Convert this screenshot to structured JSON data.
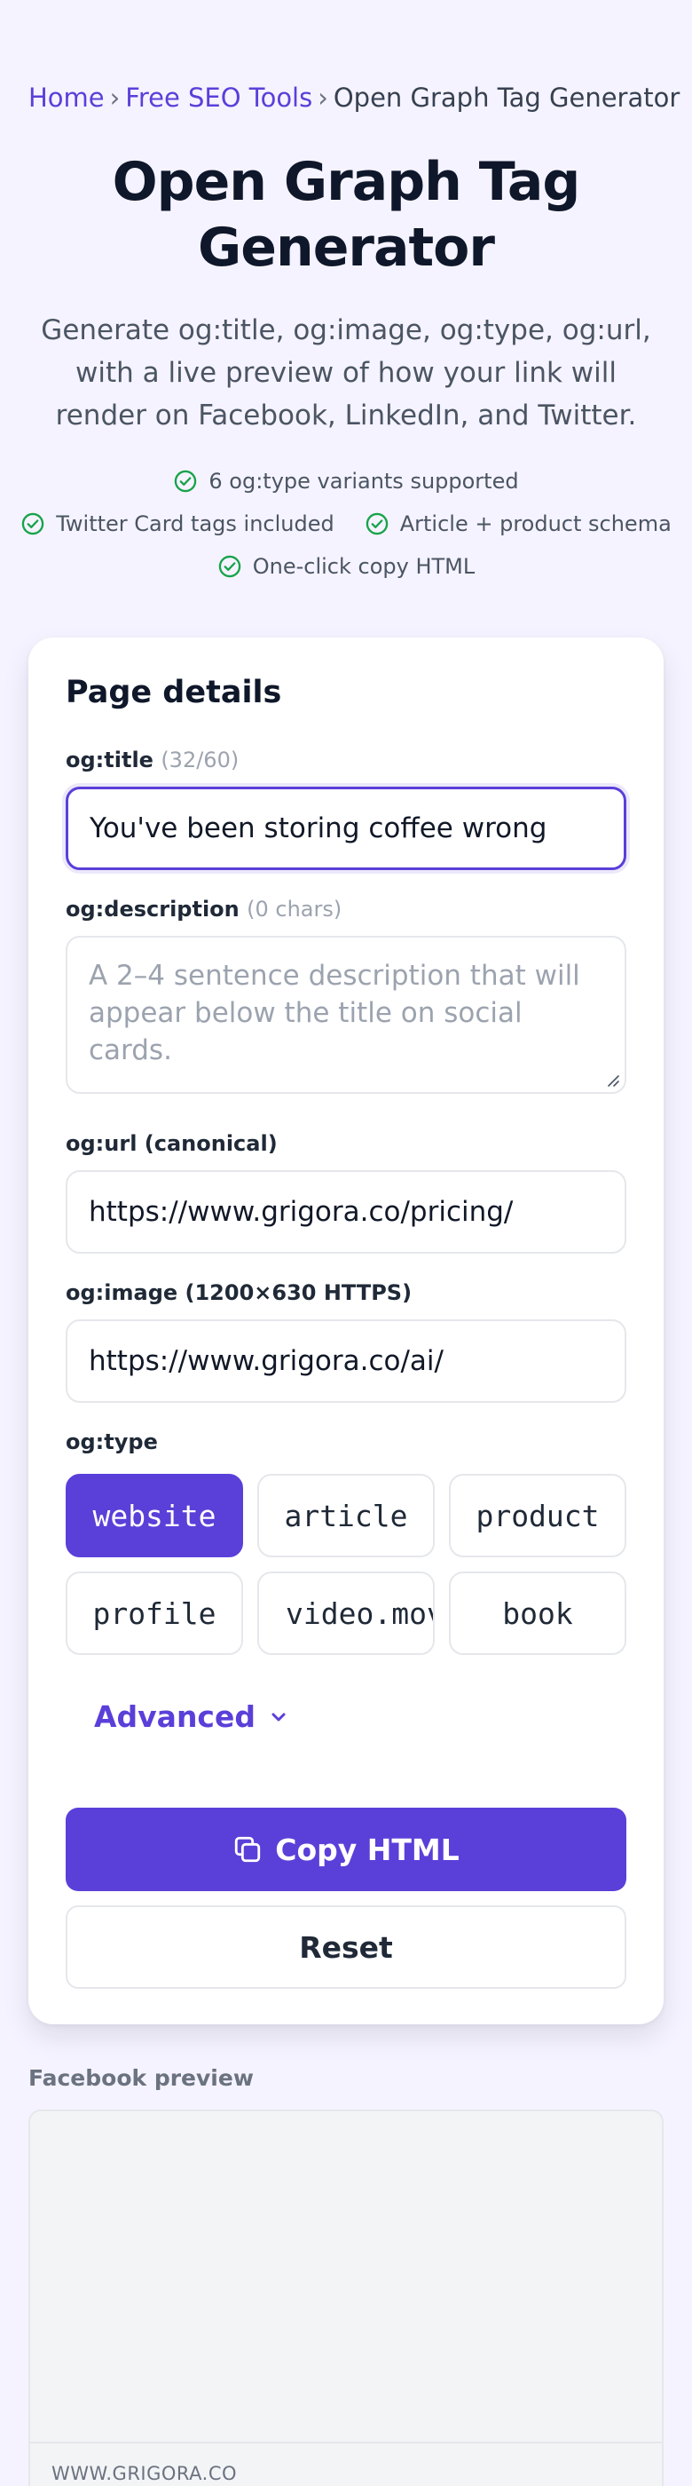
{
  "breadcrumb": {
    "home": "Home",
    "sep1": "›",
    "tools": "Free SEO Tools",
    "sep2": "›",
    "current": "Open Graph Tag Generator"
  },
  "hero": {
    "title": "Open Graph Tag Generator",
    "subtitle": "Generate og:title, og:image, og:type, og:url, with a live preview of how your link will render on Facebook, LinkedIn, and Twitter.",
    "features": [
      "6 og:type variants supported",
      "Twitter Card tags included",
      "Article + product schema",
      "One-click copy HTML"
    ],
    "feature_icon": "check-circle-icon",
    "feature_icon_color": "#16a34a"
  },
  "form": {
    "heading": "Page details",
    "title_label": "og:title",
    "title_count": "(32/60)",
    "title_value": "You've been storing coffee wrong",
    "description_label": "og:description",
    "description_count": "(0 chars)",
    "description_placeholder": "A 2–4 sentence description that will appear below the title on social cards.",
    "url_label": "og:url (canonical)",
    "url_value": "https://www.grigora.co/pricing/",
    "image_label": "og:image (1200×630 HTTPS)",
    "image_value": "https://www.grigora.co/ai/",
    "type_label": "og:type",
    "types": [
      "website",
      "article",
      "product",
      "profile",
      "video.movie",
      "book"
    ],
    "selected_type": "website",
    "advanced_label": "Advanced",
    "copy_label": "Copy HTML",
    "reset_label": "Reset"
  },
  "preview": {
    "label": "Facebook preview",
    "domain": "WWW.GRIGORA.CO"
  },
  "colors": {
    "accent": "#5b3fd9",
    "background": "#f5f3ff",
    "check": "#16a34a"
  }
}
